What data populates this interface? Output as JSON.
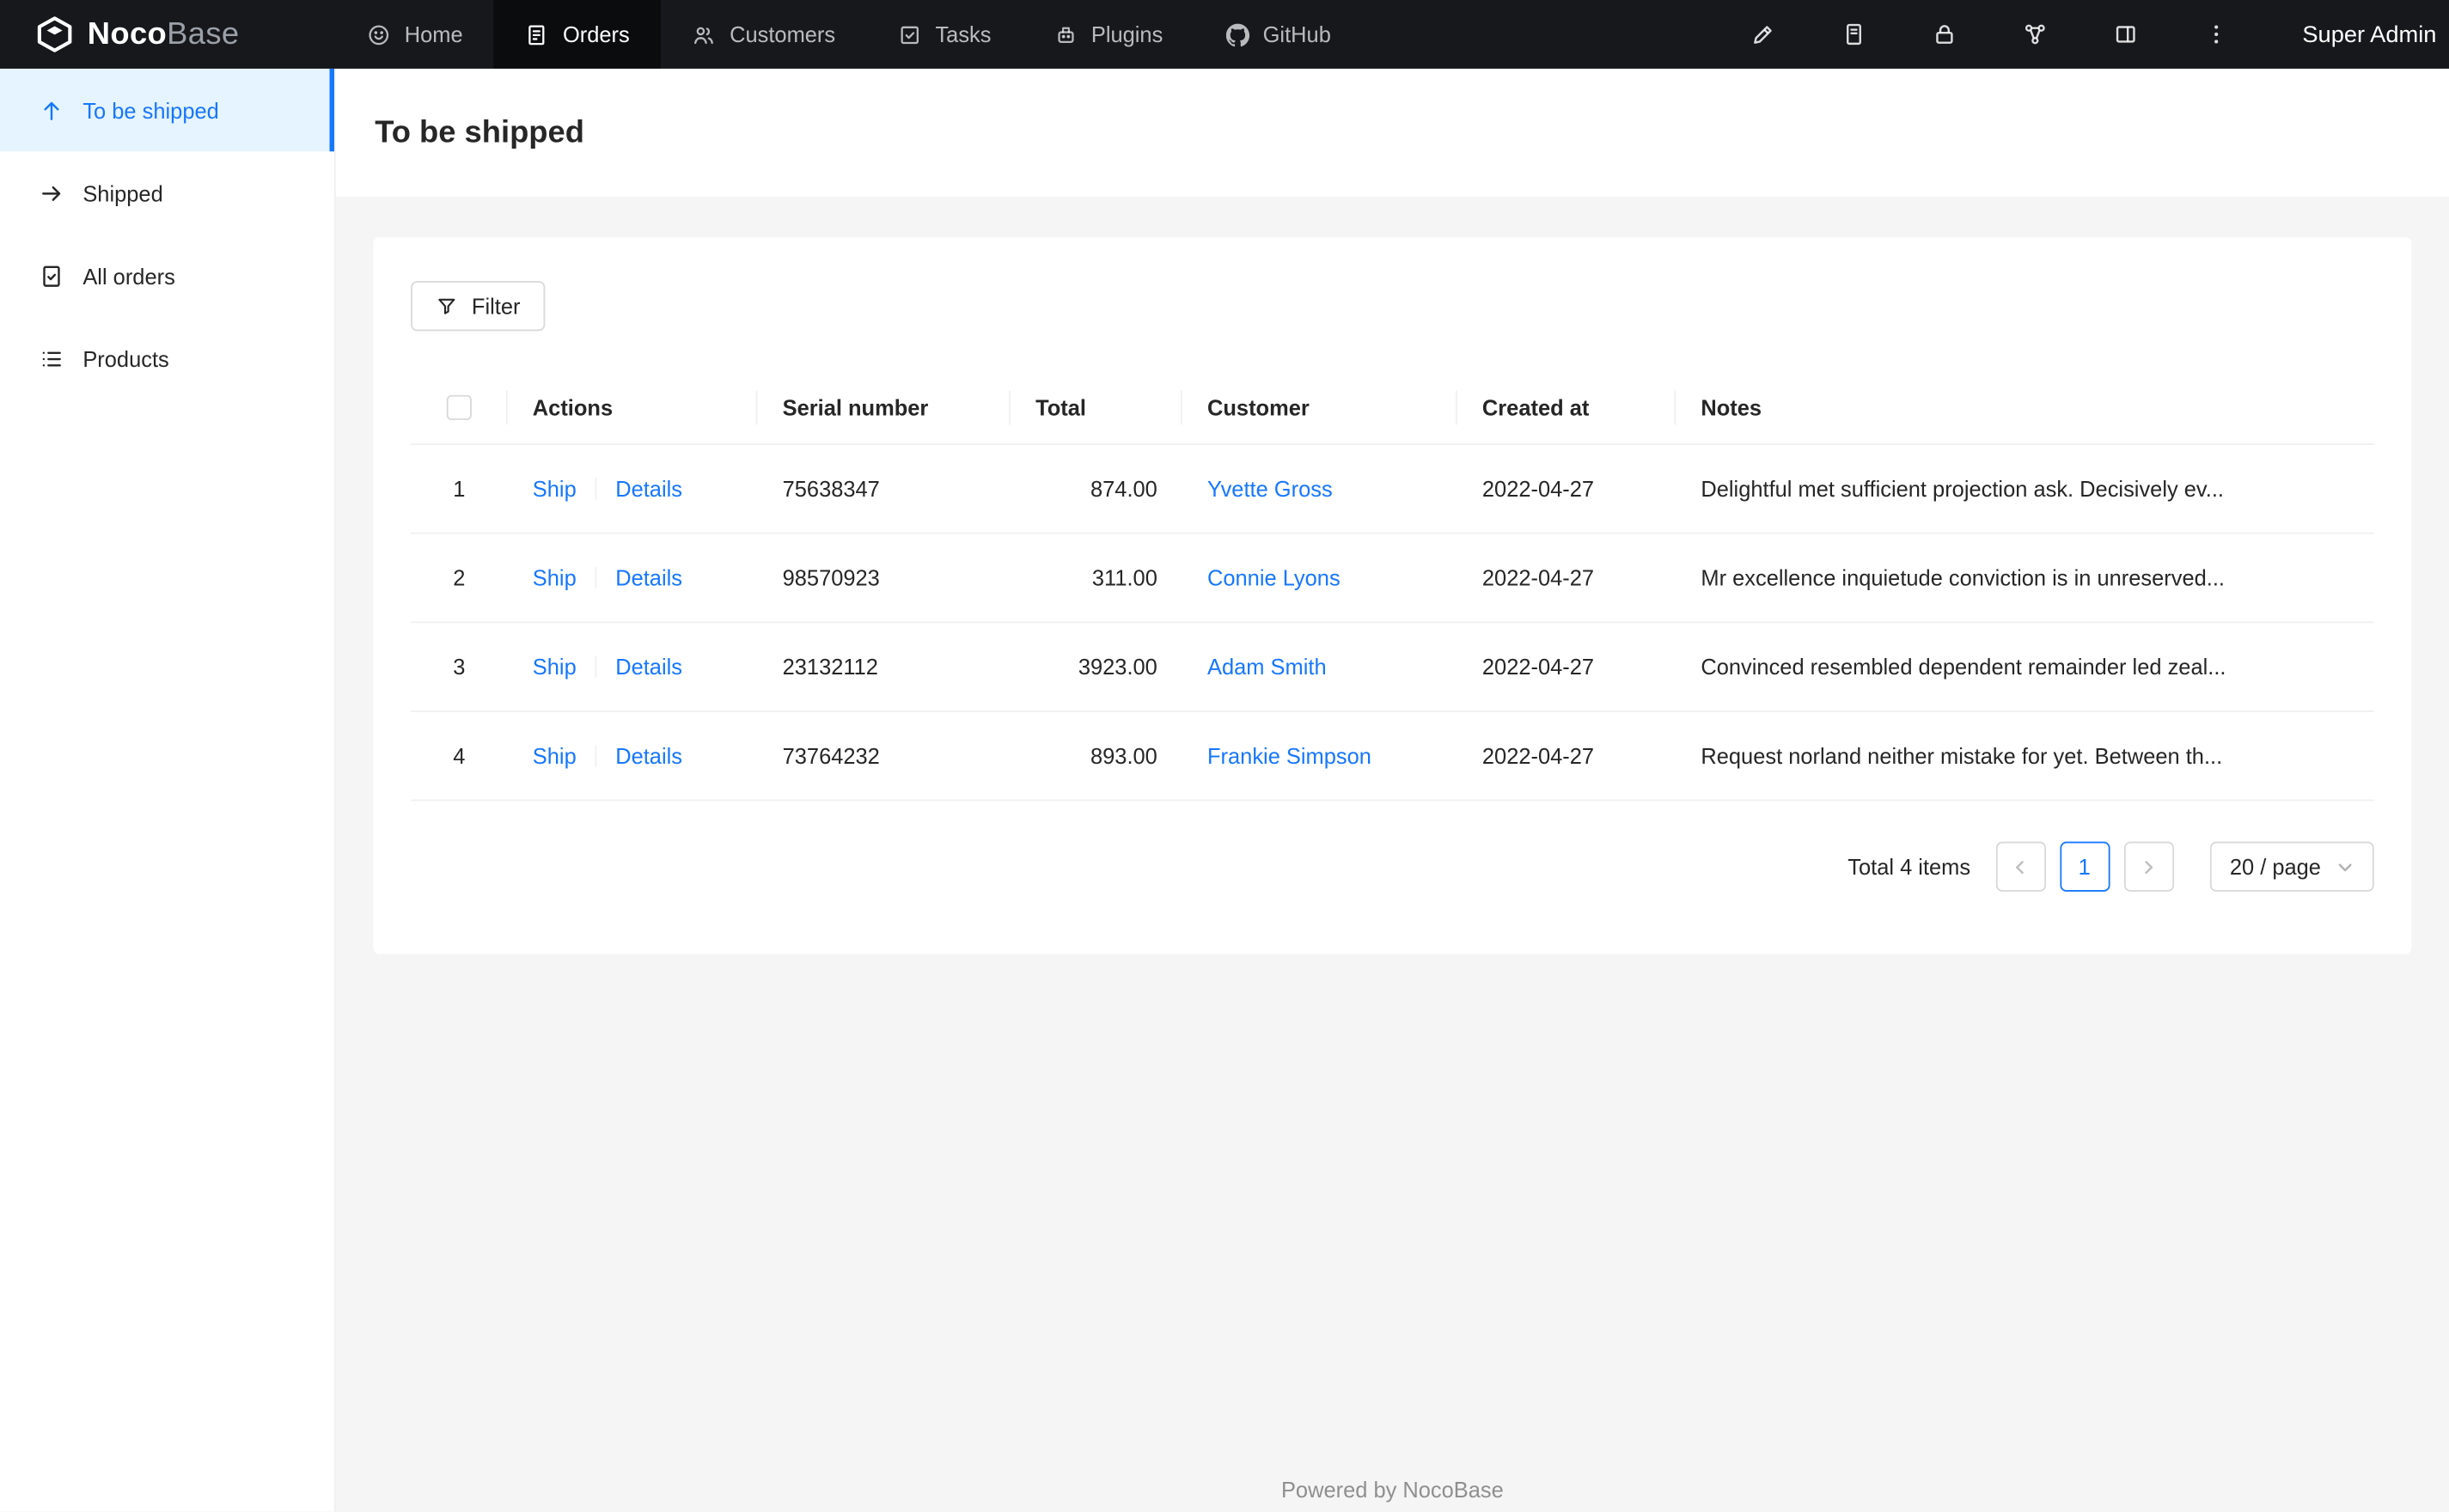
{
  "navbar": {
    "logo": {
      "bold": "Noco",
      "light": "Base"
    },
    "items": [
      {
        "label": "Home"
      },
      {
        "label": "Orders"
      },
      {
        "label": "Customers"
      },
      {
        "label": "Tasks"
      },
      {
        "label": "Plugins"
      },
      {
        "label": "GitHub"
      }
    ],
    "user": "Super Admin"
  },
  "sidebar": {
    "items": [
      {
        "label": "To be shipped"
      },
      {
        "label": "Shipped"
      },
      {
        "label": "All orders"
      },
      {
        "label": "Products"
      }
    ]
  },
  "page": {
    "title": "To be shipped"
  },
  "toolbar": {
    "filter_label": "Filter"
  },
  "table": {
    "headers": {
      "actions": "Actions",
      "serial": "Serial number",
      "total": "Total",
      "customer": "Customer",
      "created_at": "Created at",
      "notes": "Notes"
    },
    "rows": [
      {
        "index": "1",
        "ship": "Ship",
        "details": "Details",
        "serial": "75638347",
        "total": "874.00",
        "customer": "Yvette Gross",
        "created_at": "2022-04-27",
        "notes": "Delightful met sufficient projection ask. Decisively ev..."
      },
      {
        "index": "2",
        "ship": "Ship",
        "details": "Details",
        "serial": "98570923",
        "total": "311.00",
        "customer": "Connie Lyons",
        "created_at": "2022-04-27",
        "notes": "Mr excellence inquietude conviction is in unreserved..."
      },
      {
        "index": "3",
        "ship": "Ship",
        "details": "Details",
        "serial": "23132112",
        "total": "3923.00",
        "customer": "Adam Smith",
        "created_at": "2022-04-27",
        "notes": "Convinced resembled dependent remainder led zeal..."
      },
      {
        "index": "4",
        "ship": "Ship",
        "details": "Details",
        "serial": "73764232",
        "total": "893.00",
        "customer": "Frankie Simpson",
        "created_at": "2022-04-27",
        "notes": "Request norland neither mistake for yet. Between th..."
      }
    ]
  },
  "pagination": {
    "total_text": "Total 4 items",
    "current_page": "1",
    "page_size": "20 / page"
  },
  "footer": {
    "text": "Powered by NocoBase"
  },
  "colors": {
    "accent": "#1677ff",
    "navbar_bg": "#17181c",
    "sidebar_active_bg": "#e6f4ff",
    "content_bg": "#f5f5f5"
  }
}
